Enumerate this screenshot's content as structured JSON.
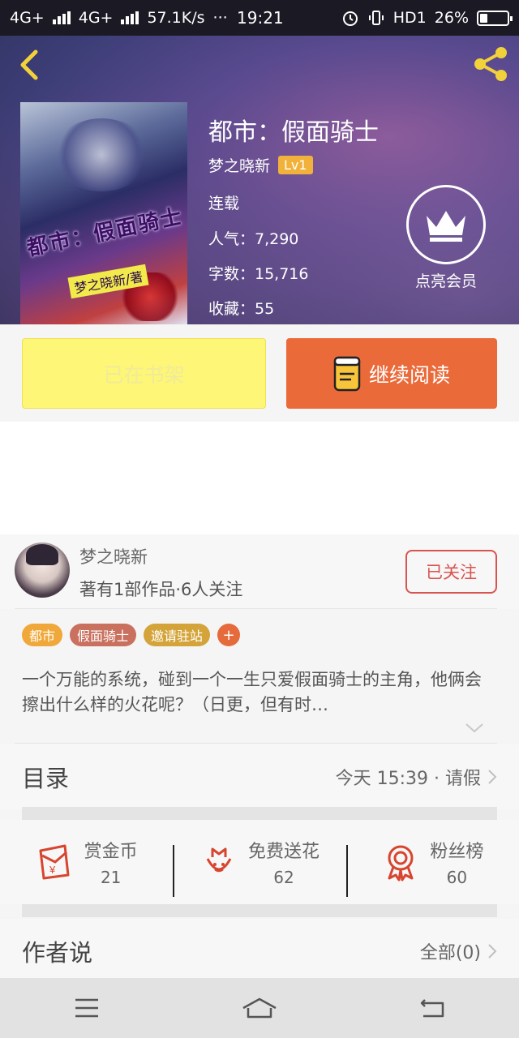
{
  "status_bar": {
    "carrier1": "4G+",
    "carrier2": "4G+",
    "speed": "57.1K/s",
    "dots": "···",
    "time": "19:21",
    "hd": "HD1",
    "battery": "26%",
    "battery_level": 0.26
  },
  "book": {
    "title": "都市：假面骑士",
    "author": "梦之晓新",
    "level": "Lv1",
    "status": "连载",
    "popularity": "人气：7,290",
    "word_count": "字数：15,716",
    "favorites": "收藏：55",
    "cover_title": "都市：假面骑士",
    "cover_subtitle": "梦之晓新/著"
  },
  "vip": {
    "label": "点亮会员"
  },
  "actions": {
    "shelf_label": "已在书架",
    "read_label": "继续阅读"
  },
  "author_card": {
    "name": "梦之晓新",
    "meta": "著有1部作品·6人关注",
    "follow_label": "已关注"
  },
  "tags": [
    {
      "label": "都市",
      "color": "#f0a83a"
    },
    {
      "label": "假面骑士",
      "color": "#c9705e"
    },
    {
      "label": "邀请驻站",
      "color": "#d4a43a"
    }
  ],
  "tag_add": "+",
  "description": "一个万能的系统，碰到一个一生只爱假面骑士的主角，他俩会擦出什么样的火花呢？（日更，但有时…",
  "toc": {
    "title": "目录",
    "update": "今天 15:39 · 请假"
  },
  "stats": [
    {
      "label": "赏金币",
      "value": "21",
      "icon": "red-envelope-icon"
    },
    {
      "label": "免费送花",
      "value": "62",
      "icon": "flower-icon"
    },
    {
      "label": "粉丝榜",
      "value": "60",
      "icon": "medal-icon"
    }
  ],
  "author_says": {
    "title": "作者说",
    "all": "全部(0)"
  },
  "colors": {
    "accent": "#eb6a3a",
    "follow": "#d9534f",
    "shelf": "#fdf677",
    "icon_red": "#d8452f"
  }
}
